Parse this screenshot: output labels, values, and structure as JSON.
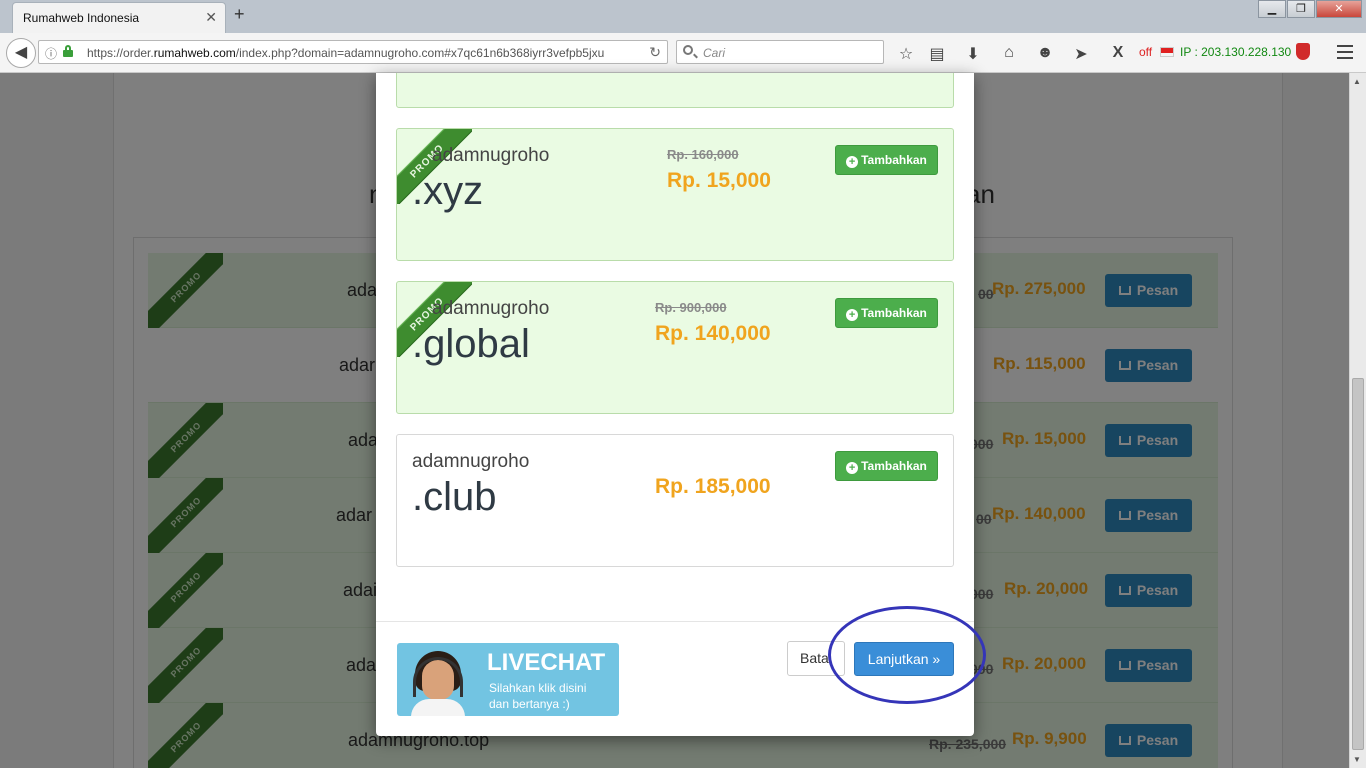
{
  "browser": {
    "tab_title": "Rumahweb Indonesia",
    "tab_close": "✕",
    "new_tab": "+",
    "url_prefix": "https://order.",
    "url_domain": "rumahweb.com",
    "url_rest": "/index.php?domain=adamnugroho.com#x7qc61n6b368iyrr3vefpb5jxu",
    "search_placeholder": "Cari",
    "ip_off": "off",
    "ip_label": "IP : 203.130.228.130",
    "win_min": "▁",
    "win_max": "❐",
    "win_close": "✕"
  },
  "colors": {
    "promo_green": "#3e8c2f",
    "price_orange": "#f0a41e",
    "pesan_blue": "#2e8bc0",
    "tambah_green": "#4cae4c",
    "lanjut_blue": "#3a8ed8",
    "highlight_circle": "#3535b8"
  },
  "background_page": {
    "heading_left": "n",
    "heading_right": "an",
    "pesan_label": "Pesan",
    "promo_label": "PROMO",
    "rows": [
      {
        "promo": true,
        "name": "adai",
        "old_price": "00",
        "price": "Rp. 275,000"
      },
      {
        "promo": false,
        "name": "adar",
        "old_price": "",
        "price": "Rp. 115,000"
      },
      {
        "promo": true,
        "name": "adai",
        "old_price": "000",
        "price": "Rp. 15,000"
      },
      {
        "promo": true,
        "name": "adar",
        "old_price": "00",
        "price": "Rp. 140,000"
      },
      {
        "promo": true,
        "name": "adai",
        "old_price": "000",
        "price": "Rp. 20,000"
      },
      {
        "promo": true,
        "name": "adai",
        "old_price": "000",
        "price": "Rp. 20,000"
      },
      {
        "promo": true,
        "name": "adamnugroho.top",
        "old_price": "Rp. 235,000",
        "price": "Rp. 9,900"
      }
    ]
  },
  "modal": {
    "promo_label": "PROMO",
    "add_label": "Tambahkan",
    "cards": [
      {
        "promo": true,
        "sld": "adamnugroho",
        "tld": ".xyz",
        "old_price": "Rp. 160,000",
        "price": "Rp. 15,000"
      },
      {
        "promo": true,
        "sld": "adamnugroho",
        "tld": ".global",
        "old_price": "Rp. 900,000",
        "price": "Rp. 140,000"
      },
      {
        "promo": false,
        "sld": "adamnugroho",
        "tld": ".club",
        "old_price": "",
        "price": "Rp. 185,000"
      }
    ],
    "livechat": {
      "title": "LIVECHAT",
      "line1": "Silahkan klik disini",
      "line2": "dan bertanya :)"
    },
    "cancel_label": "Batal",
    "continue_label": "Lanjutkan »"
  }
}
